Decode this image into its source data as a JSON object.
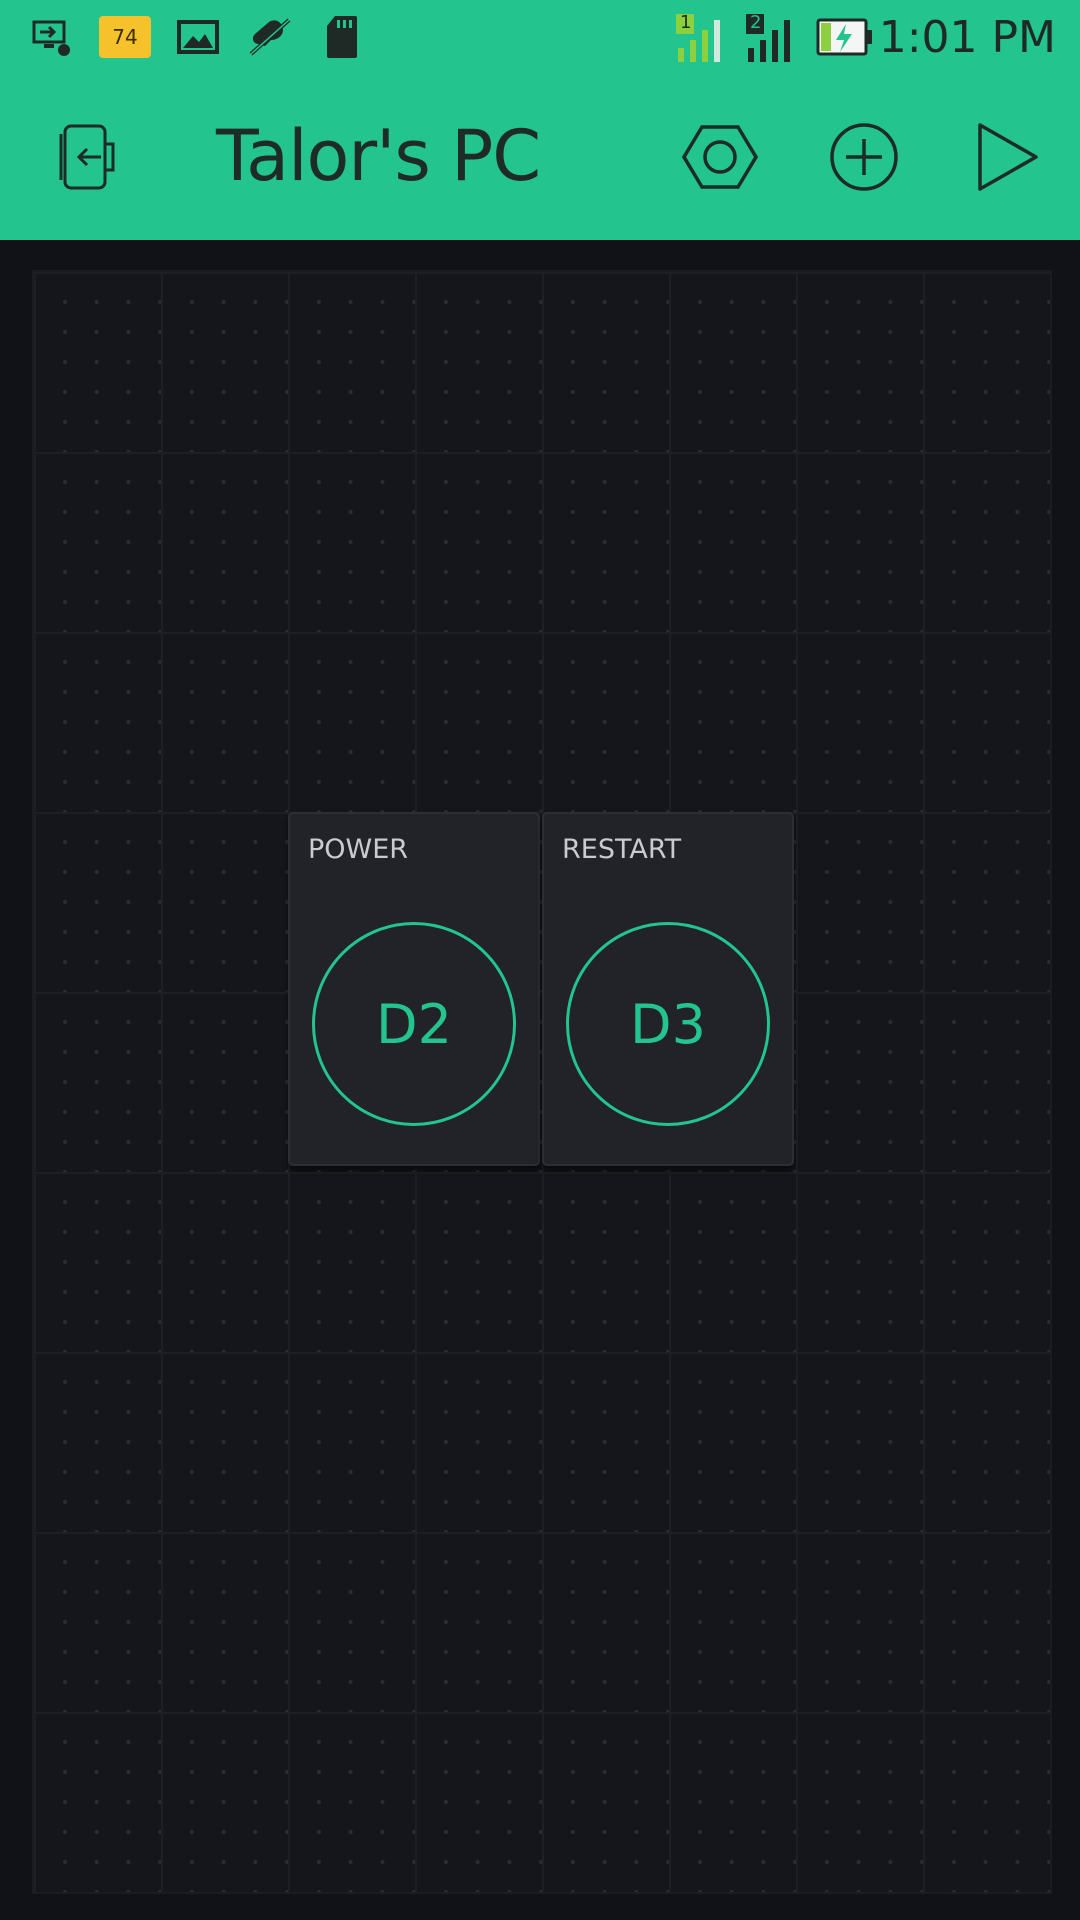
{
  "status_bar": {
    "time": "1:01 PM",
    "notification_badge": "74",
    "sim1_label": "1",
    "sim2_label": "2",
    "icons": [
      "usb-debug-icon",
      "thermometer-badge-icon",
      "gallery-icon",
      "mute-icon",
      "sd-card-icon",
      "signal-sim1-icon",
      "signal-sim2-icon",
      "battery-charging-icon"
    ]
  },
  "app_bar": {
    "title": "Talor's PC",
    "icons": [
      "exit-icon",
      "settings-icon",
      "add-icon",
      "play-icon"
    ]
  },
  "widgets": [
    {
      "label": "POWER",
      "pin": "D2"
    },
    {
      "label": "RESTART",
      "pin": "D3"
    }
  ],
  "colors": {
    "accent": "#23c48e",
    "background": "#111217",
    "widget_background": "#212328"
  }
}
